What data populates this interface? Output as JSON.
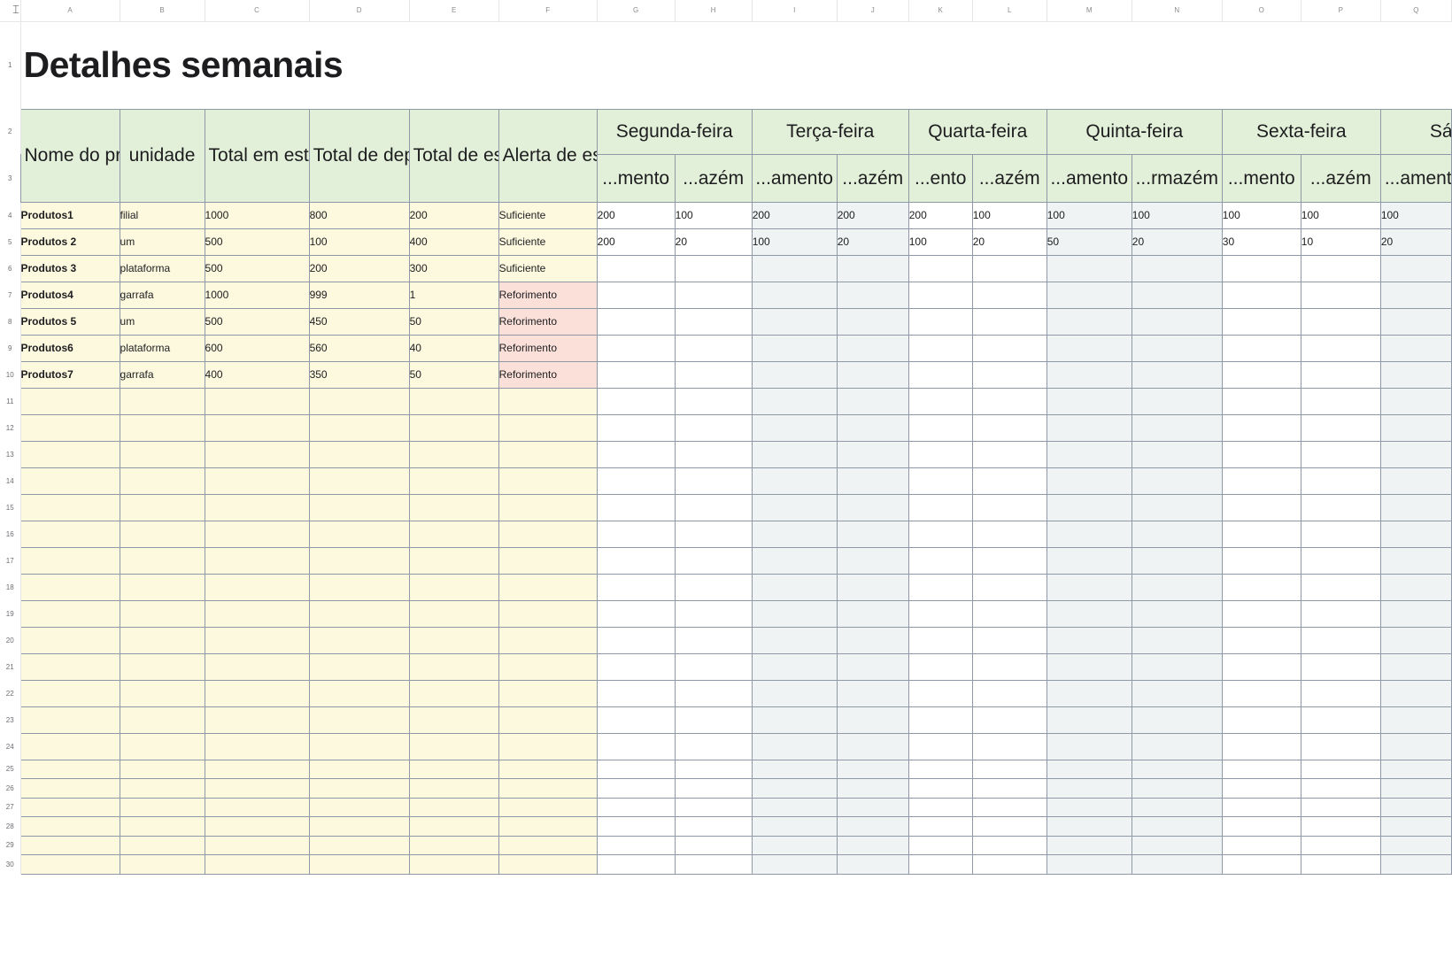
{
  "sheet": {
    "columns": [
      "A",
      "B",
      "C",
      "D",
      "E",
      "F",
      "G",
      "H",
      "I",
      "J",
      "K",
      "L",
      "M",
      "N",
      "O",
      "P",
      "Q"
    ],
    "title": "Detalhes semanais",
    "headers": {
      "name": "Nome do produto",
      "unit": "unidade",
      "total_stock": "Total em estoque",
      "total_deposits": "Total de depósitos",
      "stock_total": "Total de estoque",
      "alert": "Alerta de estoque"
    },
    "days": [
      "Segunda-feira",
      "Terça-feira",
      "Quarta-feira",
      "Quinta-feira",
      "Sexta-feira",
      "Sá"
    ],
    "subheaders": [
      "...mento",
      "...azém",
      "...amento",
      "...azém",
      "...ento",
      "...azém",
      "...amento",
      "...rmazém",
      "...mento",
      "...azém",
      "...amento"
    ],
    "rows": [
      {
        "n": "4",
        "name": "Produtos1",
        "unit": "filial",
        "c": "1000",
        "d": "800",
        "e": "200",
        "alert": "Suficiente",
        "alert_level": "ok",
        "days": [
          "200",
          "100",
          "200",
          "200",
          "200",
          "100",
          "100",
          "100",
          "100",
          "100",
          "100"
        ]
      },
      {
        "n": "5",
        "name": "Produtos 2",
        "unit": "um",
        "c": "500",
        "d": "100",
        "e": "400",
        "alert": "Suficiente",
        "alert_level": "ok",
        "days": [
          "200",
          "20",
          "100",
          "20",
          "100",
          "20",
          "50",
          "20",
          "30",
          "10",
          "20"
        ]
      },
      {
        "n": "6",
        "name": "Produtos 3",
        "unit": "plataforma",
        "c": "500",
        "d": "200",
        "e": "300",
        "alert": "Suficiente",
        "alert_level": "ok",
        "days": [
          "",
          "",
          "",
          "",
          "",
          "",
          "",
          "",
          "",
          "",
          ""
        ]
      },
      {
        "n": "7",
        "name": "Produtos4",
        "unit": "garrafa",
        "c": "1000",
        "d": "999",
        "e": "1",
        "alert": "Reforimento",
        "alert_level": "low",
        "days": [
          "",
          "",
          "",
          "",
          "",
          "",
          "",
          "",
          "",
          "",
          ""
        ]
      },
      {
        "n": "8",
        "name": "Produtos 5",
        "unit": "um",
        "c": "500",
        "d": "450",
        "e": "50",
        "alert": "Reforimento",
        "alert_level": "low",
        "days": [
          "",
          "",
          "",
          "",
          "",
          "",
          "",
          "",
          "",
          "",
          ""
        ]
      },
      {
        "n": "9",
        "name": "Produtos6",
        "unit": "plataforma",
        "c": "600",
        "d": "560",
        "e": "40",
        "alert": "Reforimento",
        "alert_level": "low",
        "days": [
          "",
          "",
          "",
          "",
          "",
          "",
          "",
          "",
          "",
          "",
          ""
        ]
      },
      {
        "n": "10",
        "name": "Produtos7",
        "unit": "garrafa",
        "c": "400",
        "d": "350",
        "e": "50",
        "alert": "Reforimento",
        "alert_level": "low",
        "days": [
          "",
          "",
          "",
          "",
          "",
          "",
          "",
          "",
          "",
          "",
          ""
        ]
      }
    ],
    "empty_rows": [
      "11",
      "12",
      "13",
      "14",
      "15",
      "16",
      "17",
      "18",
      "19",
      "20",
      "21",
      "22",
      "23",
      "24"
    ],
    "short_rows": [
      "25",
      "26",
      "27",
      "28",
      "29",
      "30"
    ],
    "colors": {
      "header_bg": "#e2efd9",
      "left_block_bg": "#fdf9df",
      "alert_low_bg": "#fbe0da",
      "alt_day_bg": "#eff3f4",
      "grid_line": "#8f98a6"
    }
  }
}
